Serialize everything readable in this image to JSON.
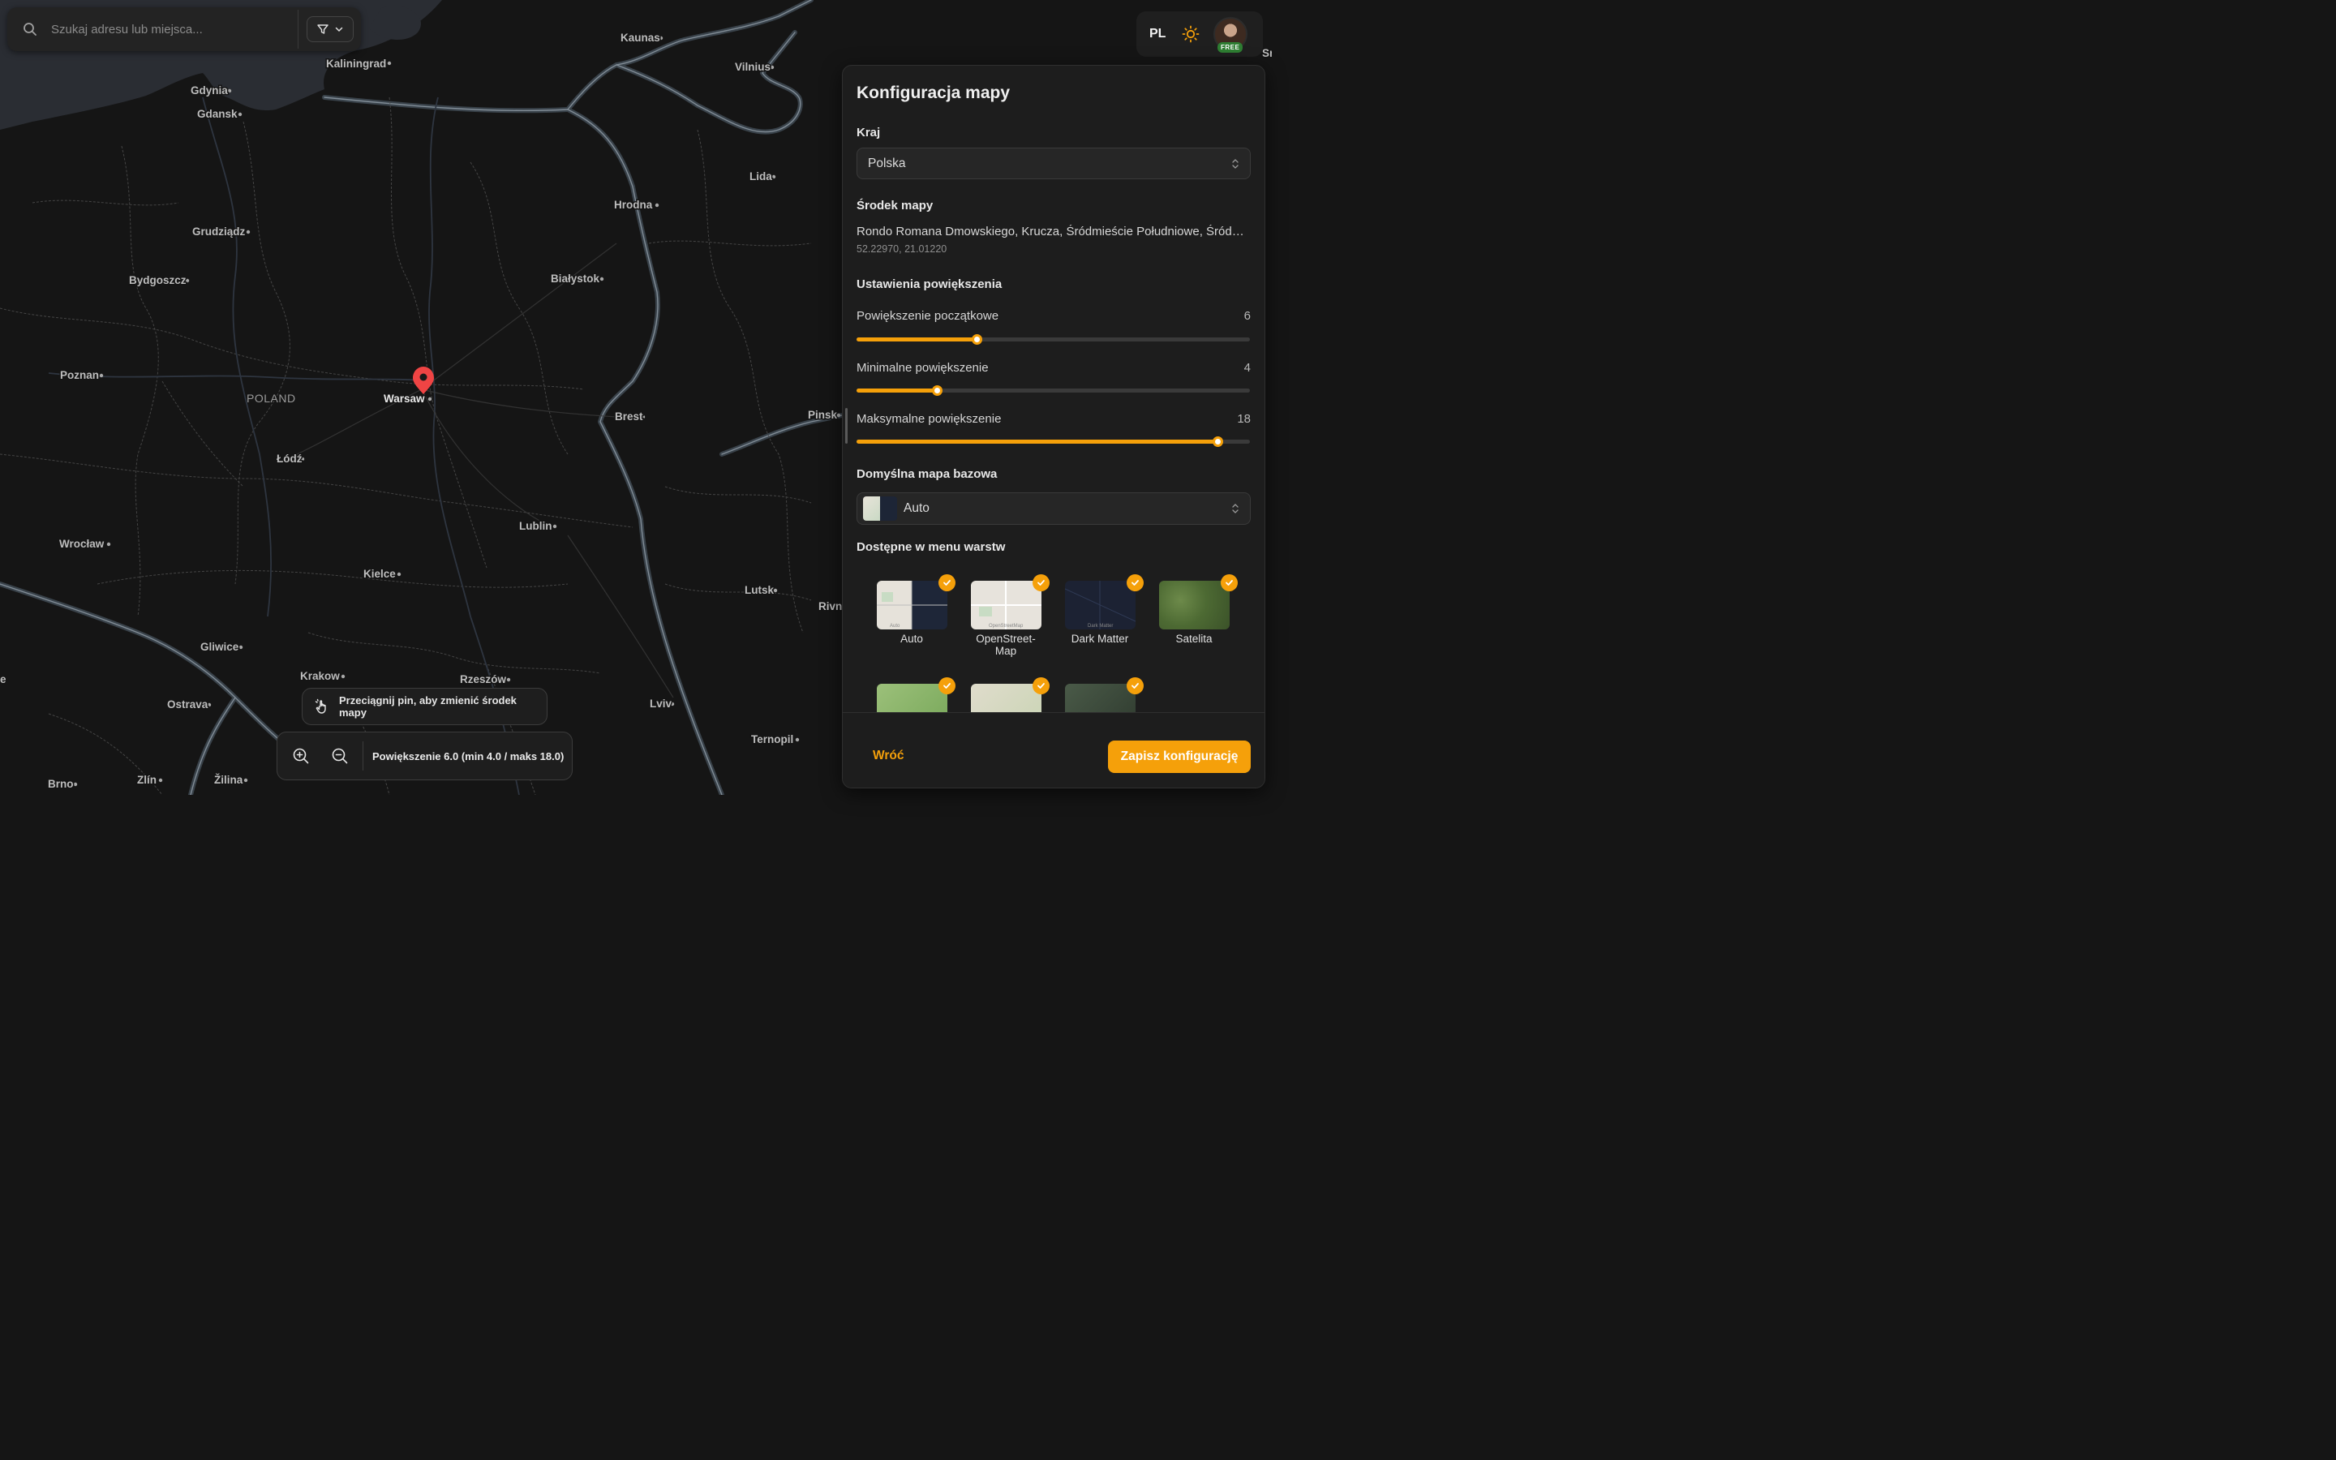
{
  "search": {
    "placeholder": "Szukaj adresu lub miejsca..."
  },
  "header": {
    "language": "PL",
    "avatar_badge": "FREE"
  },
  "map": {
    "country_label": "POLAND",
    "cities": {
      "kaliningrad": "Kaliningrad",
      "kaunas": "Kaunas",
      "vilnius": "Vilnius",
      "gdynia": "Gdynia",
      "gdansk": "Gdansk",
      "lida": "Lida",
      "hrodna": "Hrodna",
      "grudziadz": "Grudziądz",
      "bialystok": "Białystok",
      "bydgoszcz": "Bydgoszcz",
      "poznan": "Poznan",
      "warsaw": "Warsaw",
      "brest": "Brest",
      "pinsk": "Pinsk",
      "lodz": "Łódź",
      "lublin": "Lublin",
      "wroclaw": "Wrocław",
      "kielce": "Kielce",
      "lutsk": "Lutsk",
      "rivne": "Rivn",
      "gliwice": "Gliwice",
      "krakow": "Krakow",
      "rzeszow": "Rzeszów",
      "ostrava": "Ostrava",
      "lviv": "Lviv",
      "ternopil": "Ternopil",
      "brno": "Brno",
      "zlin": "Zlín",
      "zilina": "Žilina",
      "edge_e": "e",
      "edge_sr": "Sr"
    }
  },
  "panel": {
    "title": "Konfiguracja mapy",
    "country": {
      "label": "Kraj",
      "value": "Polska"
    },
    "center": {
      "label": "Środek mapy",
      "address": "Rondo Romana Dmowskiego, Krucza, Śródmieście Południowe, Śródmieście, Warszawa",
      "coords": "52.22970, 21.01220"
    },
    "zoom": {
      "label": "Ustawienia powiększenia",
      "initial": {
        "label": "Powiększenie początkowe",
        "value": "6"
      },
      "min": {
        "label": "Minimalne powiększenie",
        "value": "4"
      },
      "max": {
        "label": "Maksymalne powiększenie",
        "value": "18"
      }
    },
    "basemap": {
      "label": "Domyślna mapa bazowa",
      "value": "Auto"
    },
    "layers": {
      "label": "Dostępne w menu warstw",
      "items": [
        {
          "label": "Auto",
          "thumb_caption": "Auto"
        },
        {
          "label": "OpenStreet-\nMap",
          "thumb_caption": "OpenStreetMap"
        },
        {
          "label": "Dark Matter",
          "thumb_caption": "Dark Matter"
        },
        {
          "label": "Satelita",
          "thumb_caption": ""
        }
      ]
    },
    "back_label": "Wróć",
    "save_label": "Zapisz konfigurację"
  },
  "drag_hint": "Przeciągnij pin, aby zmienić środek mapy",
  "zoom_status": "Powiększenie 6.0 (min 4.0 / maks 18.0)",
  "colors": {
    "accent": "#f5a00a",
    "pin": "#ef4444",
    "map_bg": "#151515",
    "sea": "#2a2d33"
  }
}
